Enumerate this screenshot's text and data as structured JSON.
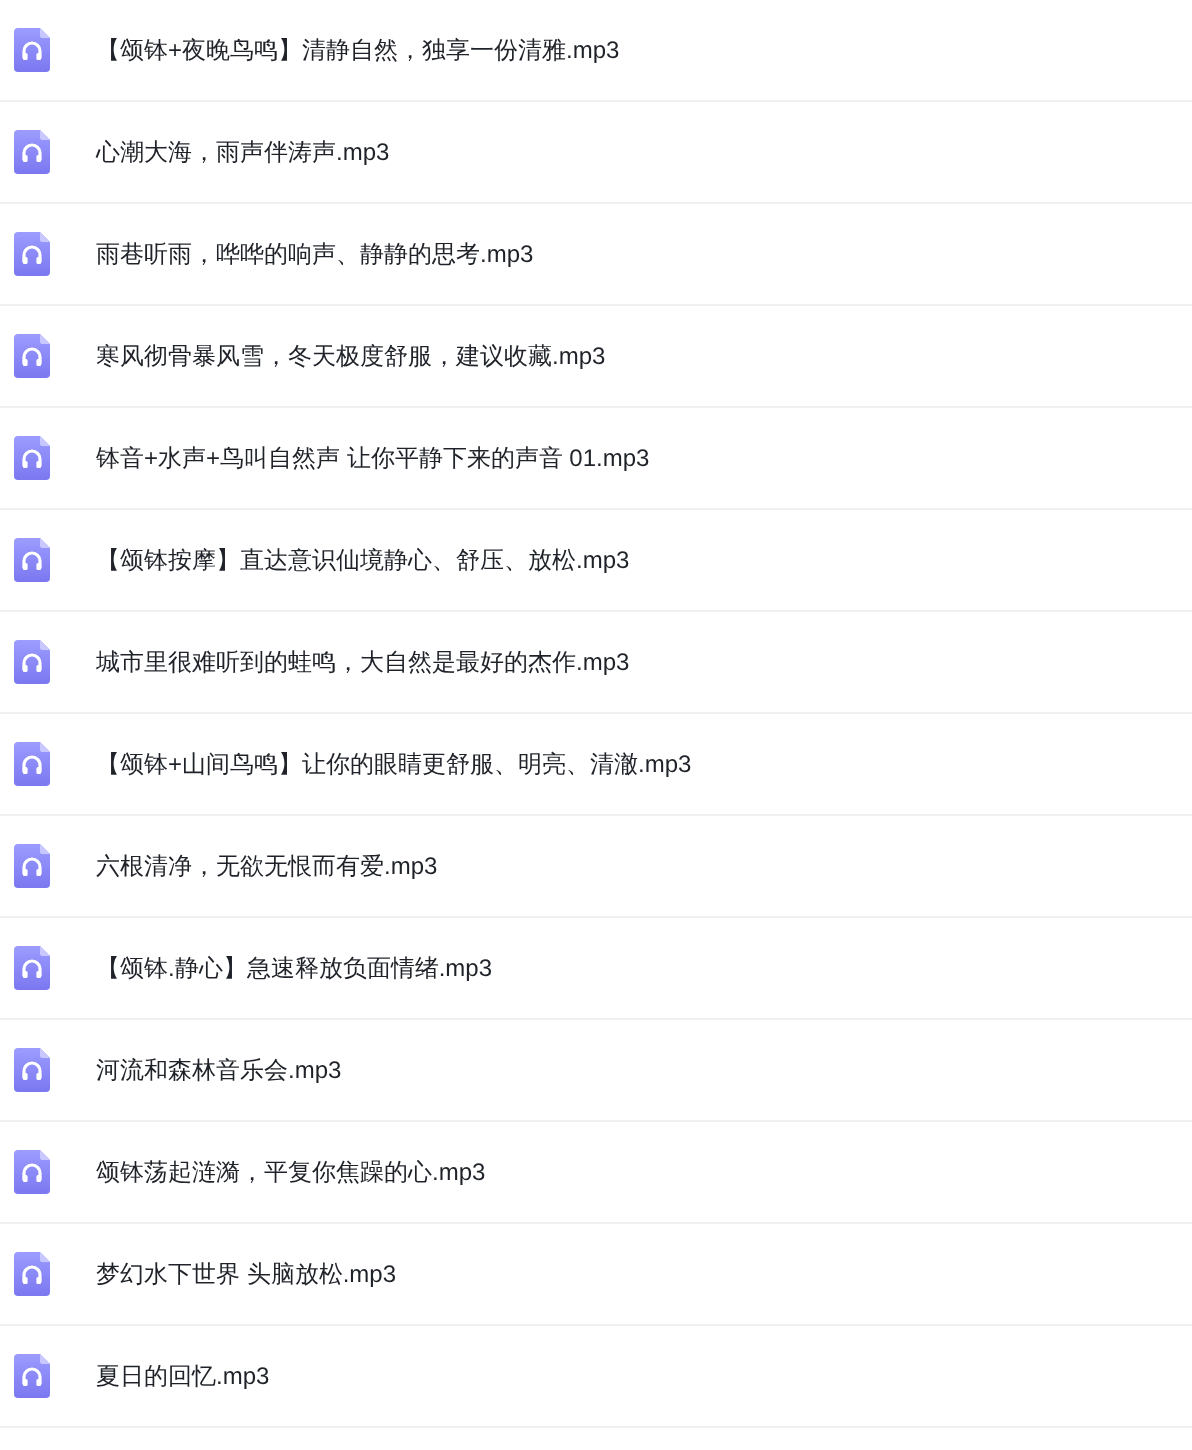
{
  "files": [
    {
      "name": "【颂钵+夜晚鸟鸣】清静自然，独享一份清雅.mp3"
    },
    {
      "name": "心潮大海，雨声伴涛声.mp3"
    },
    {
      "name": "雨巷听雨，哗哗的响声、静静的思考.mp3"
    },
    {
      "name": "寒风彻骨暴风雪，冬天极度舒服，建议收藏.mp3"
    },
    {
      "name": "钵音+水声+鸟叫自然声 让你平静下来的声音 01.mp3"
    },
    {
      "name": "【颂钵按摩】直达意识仙境静心、舒压、放松.mp3"
    },
    {
      "name": "城市里很难听到的蛙鸣，大自然是最好的杰作.mp3"
    },
    {
      "name": "【颂钵+山间鸟鸣】让你的眼睛更舒服、明亮、清澈.mp3"
    },
    {
      "name": "六根清净，无欲无恨而有爱.mp3"
    },
    {
      "name": "【颂钵.静心】急速释放负面情绪.mp3"
    },
    {
      "name": "河流和森林音乐会.mp3"
    },
    {
      "name": "颂钵荡起涟漪，平复你焦躁的心.mp3"
    },
    {
      "name": "梦幻水下世界 头脑放松.mp3"
    },
    {
      "name": "夏日的回忆.mp3"
    }
  ]
}
